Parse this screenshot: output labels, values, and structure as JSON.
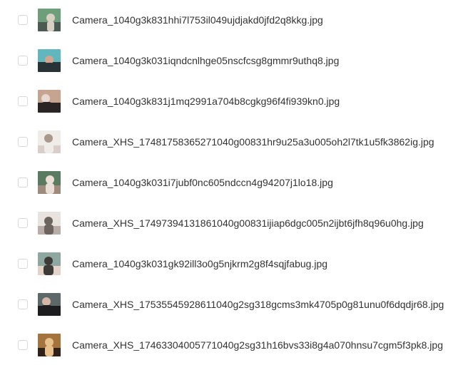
{
  "files": [
    {
      "name": "Camera_1040g3k831hhi7l753il049ujdjakd0jfd2q8kkg.jpg",
      "thumb_icon": "photo-thumbnail-icon",
      "thumb_colors": [
        "#6f9f7a",
        "#d9d0c4",
        "#4b5a52"
      ]
    },
    {
      "name": "Camera_1040g3k031iqndcnlhge05nscfcsg8gmmr9uthq8.jpg",
      "thumb_icon": "photo-thumbnail-icon",
      "thumb_colors": [
        "#62b7bf",
        "#283338",
        "#d0a690"
      ]
    },
    {
      "name": "Camera_1040g3k831j1mq2991a704b8cgkg96f4fi939kn0.jpg",
      "thumb_icon": "photo-thumbnail-icon",
      "thumb_colors": [
        "#c6a48f",
        "#2a2424",
        "#e7d8d0"
      ]
    },
    {
      "name": "Camera_XHS_17481758365271040g00831hr9u25a3u005oh2l7tk1u5fk3862ig.jpg",
      "thumb_icon": "photo-thumbnail-icon",
      "thumb_colors": [
        "#d9cfc8",
        "#f0ece8",
        "#a9988b"
      ]
    },
    {
      "name": "Camera_1040g3k031i7jubf0nc605ndccn4g94207j1lo18.jpg",
      "thumb_icon": "photo-thumbnail-icon",
      "thumb_colors": [
        "#5a7b5f",
        "#e9dfd6",
        "#9d8c7e"
      ]
    },
    {
      "name": "Camera_XHS_17497394131861040g00831ijiap6dgc005n2ijbt6jfh8q96u0hg.jpg",
      "thumb_icon": "photo-thumbnail-icon",
      "thumb_colors": [
        "#b8aea7",
        "#6d6460",
        "#e9e3df"
      ]
    },
    {
      "name": "Camera_1040g3k031gk92ill3o0g5njkrm2g8f4sqjfabug.jpg",
      "thumb_icon": "photo-thumbnail-icon",
      "thumb_colors": [
        "#8ea7a1",
        "#3d3a38",
        "#e3d3c8"
      ]
    },
    {
      "name": "Camera_XHS_17535545928611040g2sg318gcms3mk4705p0g81unu0f6dqdjr68.jpg",
      "thumb_icon": "photo-thumbnail-icon",
      "thumb_colors": [
        "#5d6869",
        "#1d1d20",
        "#d5b6a6"
      ]
    },
    {
      "name": "Camera_XHS_17463304005771040g2sg31h16bvs33i8g4a070hnsu7cgm5f3pk8.jpg",
      "thumb_icon": "photo-thumbnail-icon",
      "thumb_colors": [
        "#a4743e",
        "#2f2117",
        "#e8c08b"
      ]
    }
  ]
}
